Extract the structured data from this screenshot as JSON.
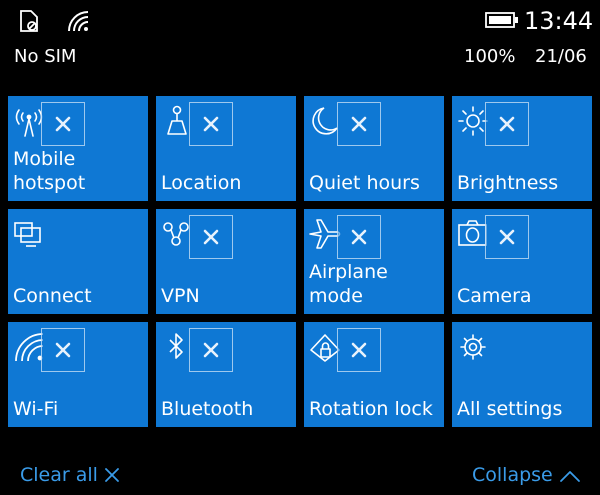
{
  "status": {
    "time": "13:44",
    "carrier": "No SIM",
    "battery": "100%",
    "date": "21/06",
    "icons": [
      "no-sim-icon",
      "wifi-signal-icon",
      "battery-icon"
    ]
  },
  "tiles": [
    {
      "label_lines": [
        "Mobile",
        "hotspot"
      ],
      "icon": "mobile-hotspot-icon",
      "removable": true
    },
    {
      "label_lines": [
        "Location"
      ],
      "icon": "location-icon",
      "removable": true
    },
    {
      "label_lines": [
        "Quiet hours"
      ],
      "icon": "moon-icon",
      "removable": true
    },
    {
      "label_lines": [
        "Brightness"
      ],
      "icon": "sun-icon",
      "removable": true
    },
    {
      "label_lines": [
        "Connect"
      ],
      "icon": "connect-display-icon",
      "removable": false
    },
    {
      "label_lines": [
        "VPN"
      ],
      "icon": "vpn-icon",
      "removable": true
    },
    {
      "label_lines": [
        "Airplane",
        "mode"
      ],
      "icon": "airplane-icon",
      "removable": true
    },
    {
      "label_lines": [
        "Camera"
      ],
      "icon": "camera-icon",
      "removable": true
    },
    {
      "label_lines": [
        "Wi-Fi"
      ],
      "icon": "wifi-icon",
      "removable": true
    },
    {
      "label_lines": [
        "Bluetooth"
      ],
      "icon": "bluetooth-icon",
      "removable": true
    },
    {
      "label_lines": [
        "Rotation lock"
      ],
      "icon": "rotation-lock-icon",
      "removable": true
    },
    {
      "label_lines": [
        "All settings"
      ],
      "icon": "gear-icon",
      "removable": false
    }
  ],
  "footer": {
    "clear_all": "Clear all",
    "collapse": "Collapse"
  },
  "colors": {
    "tile": "#0f78d4",
    "link": "#3a9be8",
    "background": "#000000"
  }
}
